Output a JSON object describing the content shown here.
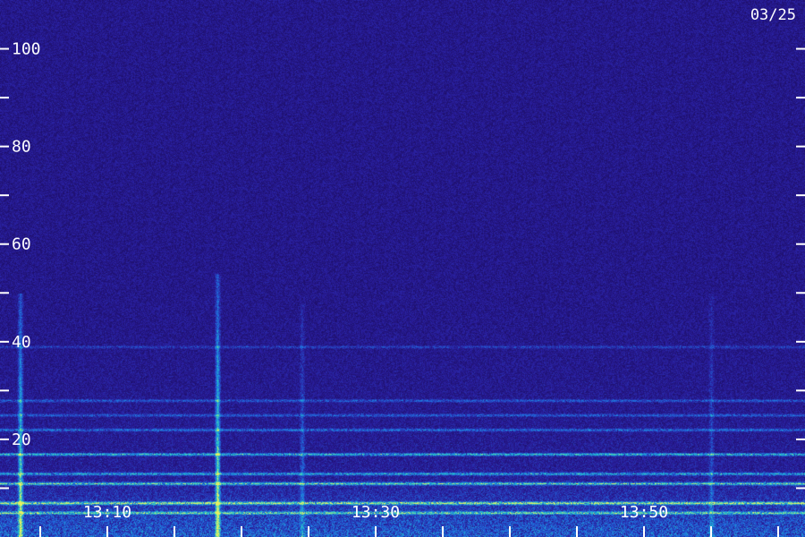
{
  "date_label": "03/25",
  "chart_data": {
    "type": "heatmap",
    "title": "",
    "xlabel": "",
    "ylabel": "",
    "ylim": [
      0,
      110
    ],
    "y_ticks": [
      20,
      40,
      60,
      80,
      100
    ],
    "y_minor_ticks": [
      10,
      30,
      50,
      70,
      90
    ],
    "x_ticks": [
      "13:10",
      "13:30",
      "13:50"
    ],
    "xlim": [
      "13:02",
      "14:02"
    ],
    "x_minor_tick_minutes": [
      5
    ],
    "colormap": [
      "#1a0a5a",
      "#2a1fa0",
      "#1f6fe0",
      "#23c8c8",
      "#e8f060"
    ],
    "vertical_streaks": [
      {
        "time": "13:03.5",
        "top_freq": 50,
        "intensity": 0.9
      },
      {
        "time": "13:18.2",
        "top_freq": 54,
        "intensity": 0.95
      },
      {
        "time": "13:24.5",
        "top_freq": 48,
        "intensity": 0.35
      },
      {
        "time": "13:55.0",
        "top_freq": 50,
        "intensity": 0.3
      }
    ],
    "horizontal_bands": [
      {
        "freq": 5,
        "intensity": 0.7
      },
      {
        "freq": 7,
        "intensity": 0.9
      },
      {
        "freq": 11,
        "intensity": 0.75
      },
      {
        "freq": 13,
        "intensity": 0.6
      },
      {
        "freq": 17,
        "intensity": 0.7
      },
      {
        "freq": 22,
        "intensity": 0.4
      },
      {
        "freq": 25,
        "intensity": 0.35
      },
      {
        "freq": 28,
        "intensity": 0.35
      },
      {
        "freq": 39,
        "intensity": 0.25
      }
    ]
  }
}
